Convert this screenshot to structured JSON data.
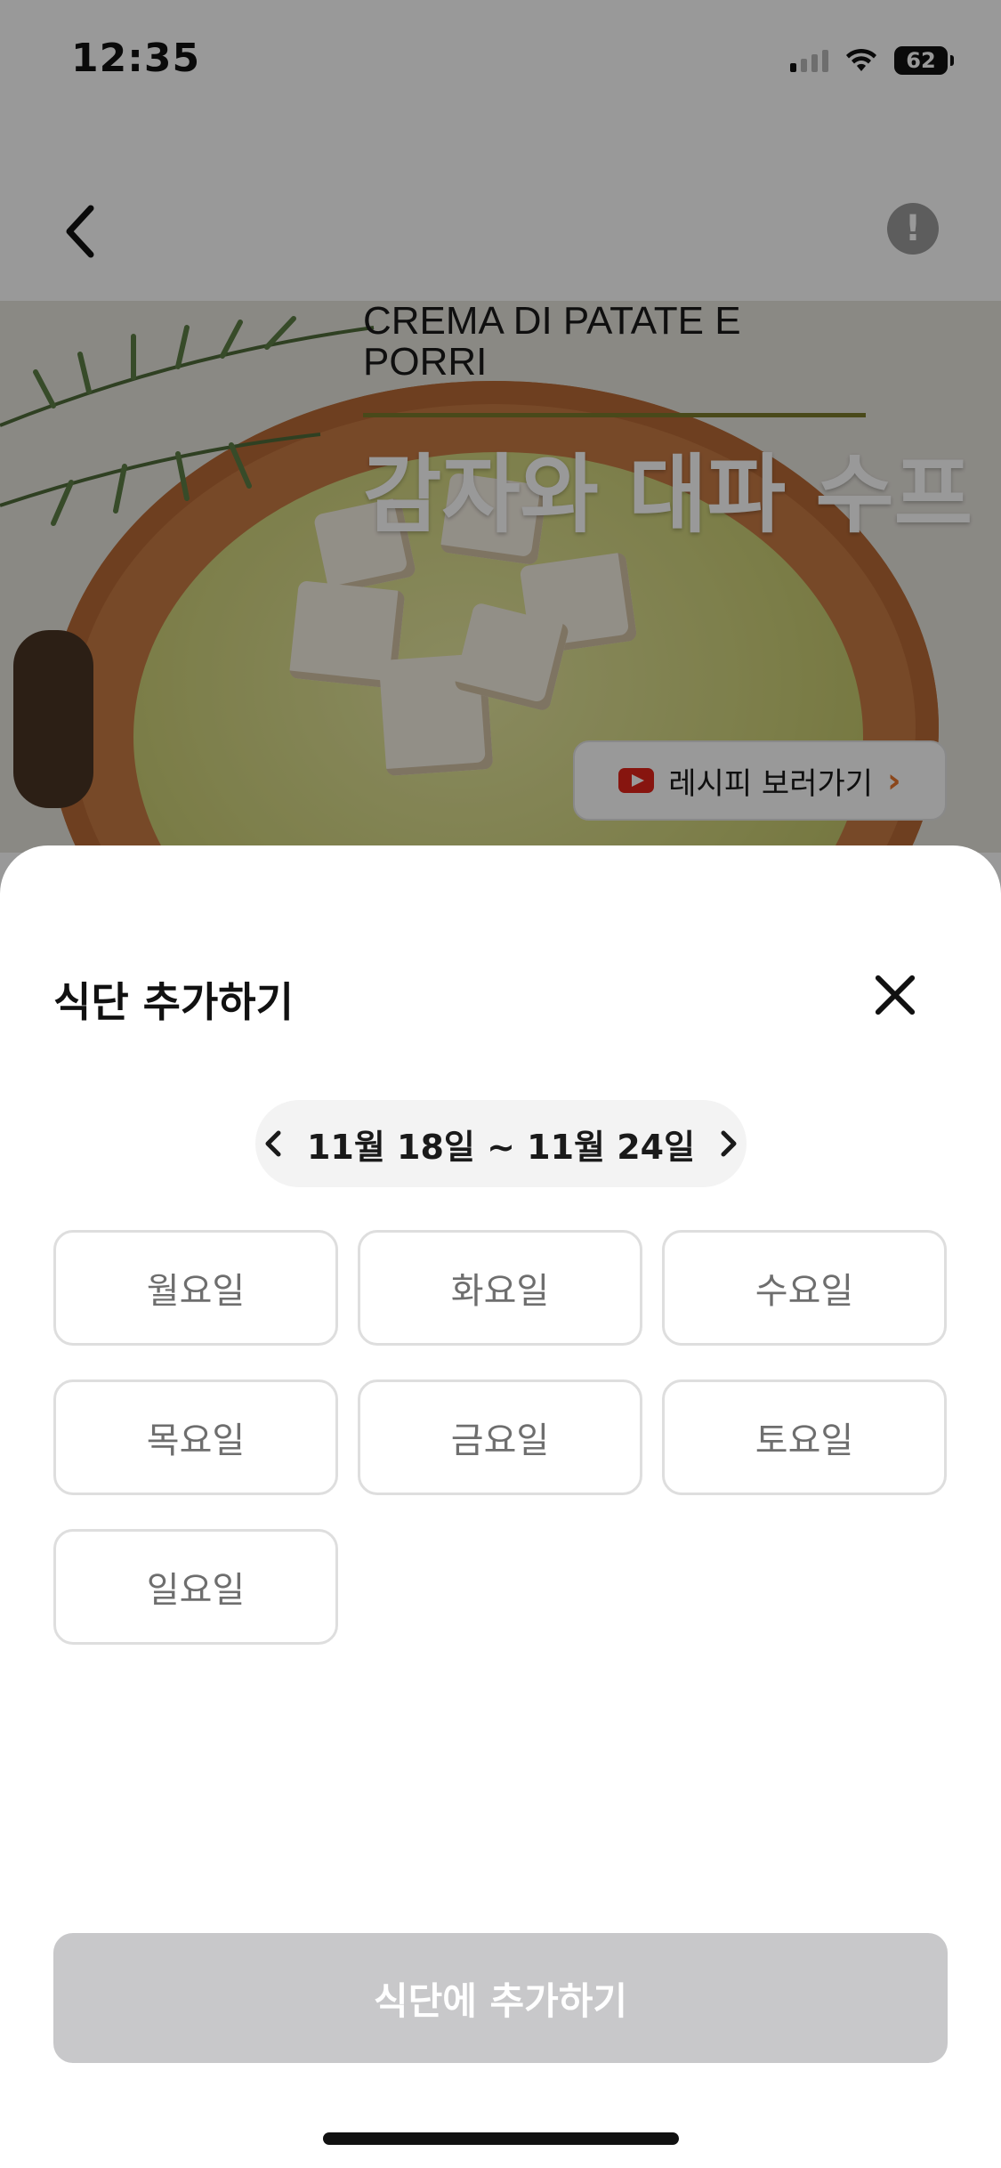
{
  "status_bar": {
    "time": "12:35",
    "battery": "62"
  },
  "nav": {
    "back_icon": "chevron-left-icon",
    "report_icon": "exclamation-icon"
  },
  "recipe": {
    "title_en": "CREMA DI PATATE E PORRI",
    "title_ko": "감자와 대파 수프",
    "video_button_label": "레시피 보러가기"
  },
  "sheet": {
    "title": "식단 추가하기",
    "week_range": "11월 18일 ~ 11월 24일",
    "days": [
      "월요일",
      "화요일",
      "수요일",
      "목요일",
      "금요일",
      "토요일",
      "일요일"
    ],
    "submit_label": "식단에 추가하기"
  },
  "colors": {
    "overlay": "#000000",
    "submit_disabled": "#c8c8ca",
    "accent_orange": "#e8772e"
  }
}
